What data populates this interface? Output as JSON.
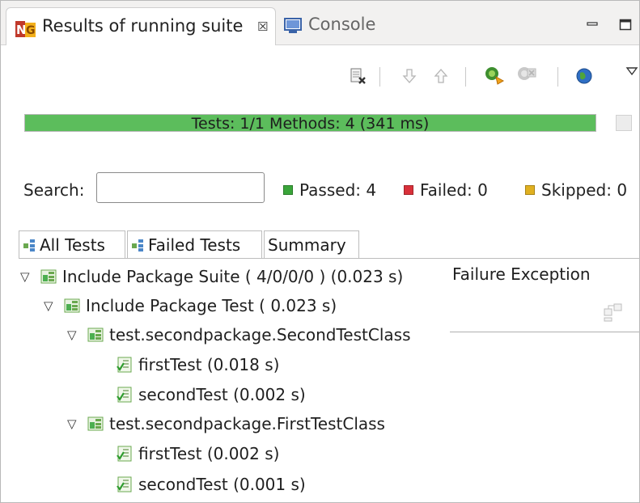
{
  "tabs": {
    "results_label": "Results of running suite",
    "results_close": "☒",
    "console_label": "Console"
  },
  "progress": {
    "text": "Tests: 1/1  Methods: 4 (341 ms)",
    "fraction": 1.0,
    "color": "#5cbd5c"
  },
  "search": {
    "label": "Search:",
    "value": "",
    "placeholder": ""
  },
  "stats": {
    "passed": "Passed: 4",
    "failed": "Failed: 0",
    "skipped": "Skipped: 0",
    "passed_color": "#3aa53a",
    "failed_color": "#d9303a",
    "skipped_color": "#e0b020"
  },
  "result_tabs": {
    "all": "All Tests",
    "failed": "Failed Tests",
    "summary": "Summary"
  },
  "tree": {
    "suite": "Include Package Suite ( 4/0/0/0 ) (0.023 s)",
    "test": "Include Package Test ( 0.023 s)",
    "class1": "test.secondpackage.SecondTestClass",
    "c1m1": "firstTest  (0.018 s)",
    "c1m2": "secondTest  (0.002 s)",
    "class2": "test.secondpackage.FirstTestClass",
    "c2m1": "firstTest  (0.002 s)",
    "c2m2": "secondTest  (0.001 s)"
  },
  "failure_panel": {
    "title": "Failure Exception"
  },
  "icons": {
    "tab": "testng-icon",
    "console": "console-icon",
    "tree_suite": "suite-icon",
    "tree_method": "method-icon"
  }
}
